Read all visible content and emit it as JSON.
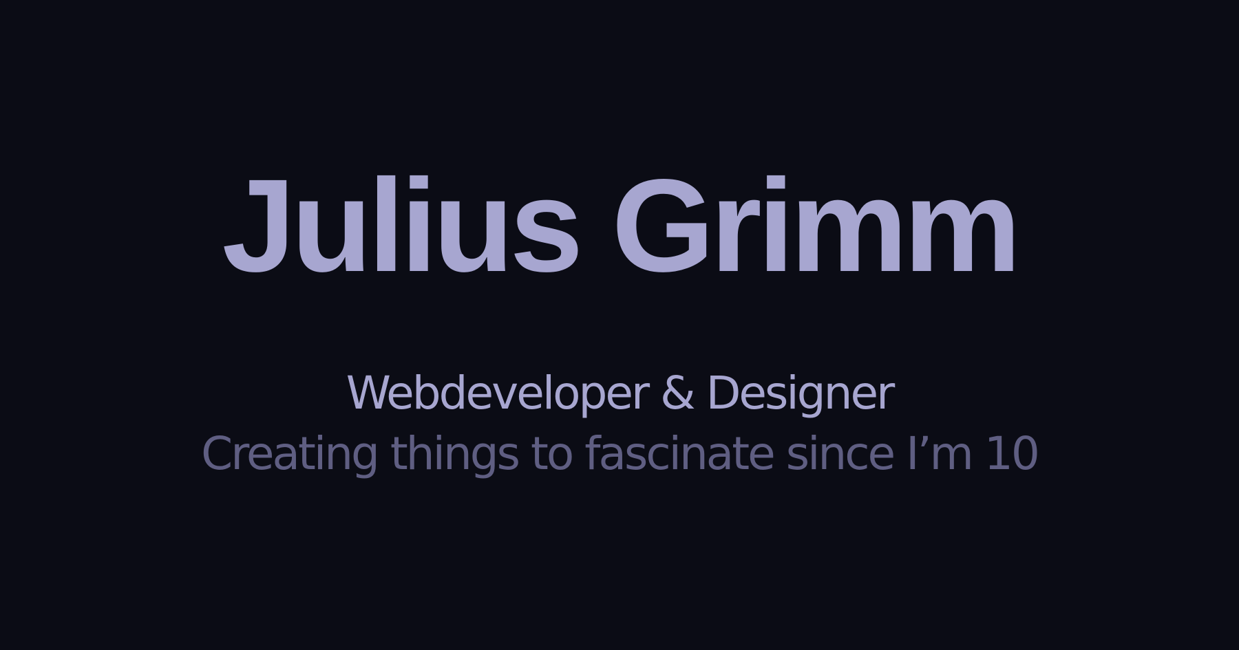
{
  "hero": {
    "name": "Julius Grimm",
    "role": "Webdeveloper & Designer",
    "tagline": "Creating things to fascinate since I’m 10"
  },
  "colors": {
    "background": "#0b0c15",
    "primary_text": "#a7a6d0",
    "secondary_text": "#5f5e82"
  }
}
